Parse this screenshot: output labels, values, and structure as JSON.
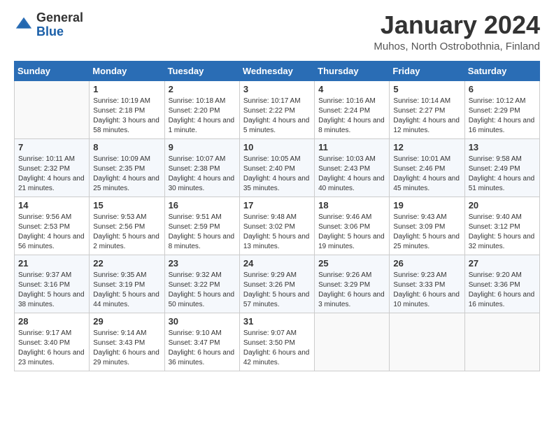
{
  "header": {
    "logo_general": "General",
    "logo_blue": "Blue",
    "month_title": "January 2024",
    "subtitle": "Muhos, North Ostrobothnia, Finland"
  },
  "days_of_week": [
    "Sunday",
    "Monday",
    "Tuesday",
    "Wednesday",
    "Thursday",
    "Friday",
    "Saturday"
  ],
  "weeks": [
    [
      {
        "day": "",
        "sunrise": "",
        "sunset": "",
        "daylight": ""
      },
      {
        "day": "1",
        "sunrise": "Sunrise: 10:19 AM",
        "sunset": "Sunset: 2:18 PM",
        "daylight": "Daylight: 3 hours and 58 minutes."
      },
      {
        "day": "2",
        "sunrise": "Sunrise: 10:18 AM",
        "sunset": "Sunset: 2:20 PM",
        "daylight": "Daylight: 4 hours and 1 minute."
      },
      {
        "day": "3",
        "sunrise": "Sunrise: 10:17 AM",
        "sunset": "Sunset: 2:22 PM",
        "daylight": "Daylight: 4 hours and 5 minutes."
      },
      {
        "day": "4",
        "sunrise": "Sunrise: 10:16 AM",
        "sunset": "Sunset: 2:24 PM",
        "daylight": "Daylight: 4 hours and 8 minutes."
      },
      {
        "day": "5",
        "sunrise": "Sunrise: 10:14 AM",
        "sunset": "Sunset: 2:27 PM",
        "daylight": "Daylight: 4 hours and 12 minutes."
      },
      {
        "day": "6",
        "sunrise": "Sunrise: 10:12 AM",
        "sunset": "Sunset: 2:29 PM",
        "daylight": "Daylight: 4 hours and 16 minutes."
      }
    ],
    [
      {
        "day": "7",
        "sunrise": "Sunrise: 10:11 AM",
        "sunset": "Sunset: 2:32 PM",
        "daylight": "Daylight: 4 hours and 21 minutes."
      },
      {
        "day": "8",
        "sunrise": "Sunrise: 10:09 AM",
        "sunset": "Sunset: 2:35 PM",
        "daylight": "Daylight: 4 hours and 25 minutes."
      },
      {
        "day": "9",
        "sunrise": "Sunrise: 10:07 AM",
        "sunset": "Sunset: 2:38 PM",
        "daylight": "Daylight: 4 hours and 30 minutes."
      },
      {
        "day": "10",
        "sunrise": "Sunrise: 10:05 AM",
        "sunset": "Sunset: 2:40 PM",
        "daylight": "Daylight: 4 hours and 35 minutes."
      },
      {
        "day": "11",
        "sunrise": "Sunrise: 10:03 AM",
        "sunset": "Sunset: 2:43 PM",
        "daylight": "Daylight: 4 hours and 40 minutes."
      },
      {
        "day": "12",
        "sunrise": "Sunrise: 10:01 AM",
        "sunset": "Sunset: 2:46 PM",
        "daylight": "Daylight: 4 hours and 45 minutes."
      },
      {
        "day": "13",
        "sunrise": "Sunrise: 9:58 AM",
        "sunset": "Sunset: 2:49 PM",
        "daylight": "Daylight: 4 hours and 51 minutes."
      }
    ],
    [
      {
        "day": "14",
        "sunrise": "Sunrise: 9:56 AM",
        "sunset": "Sunset: 2:53 PM",
        "daylight": "Daylight: 4 hours and 56 minutes."
      },
      {
        "day": "15",
        "sunrise": "Sunrise: 9:53 AM",
        "sunset": "Sunset: 2:56 PM",
        "daylight": "Daylight: 5 hours and 2 minutes."
      },
      {
        "day": "16",
        "sunrise": "Sunrise: 9:51 AM",
        "sunset": "Sunset: 2:59 PM",
        "daylight": "Daylight: 5 hours and 8 minutes."
      },
      {
        "day": "17",
        "sunrise": "Sunrise: 9:48 AM",
        "sunset": "Sunset: 3:02 PM",
        "daylight": "Daylight: 5 hours and 13 minutes."
      },
      {
        "day": "18",
        "sunrise": "Sunrise: 9:46 AM",
        "sunset": "Sunset: 3:06 PM",
        "daylight": "Daylight: 5 hours and 19 minutes."
      },
      {
        "day": "19",
        "sunrise": "Sunrise: 9:43 AM",
        "sunset": "Sunset: 3:09 PM",
        "daylight": "Daylight: 5 hours and 25 minutes."
      },
      {
        "day": "20",
        "sunrise": "Sunrise: 9:40 AM",
        "sunset": "Sunset: 3:12 PM",
        "daylight": "Daylight: 5 hours and 32 minutes."
      }
    ],
    [
      {
        "day": "21",
        "sunrise": "Sunrise: 9:37 AM",
        "sunset": "Sunset: 3:16 PM",
        "daylight": "Daylight: 5 hours and 38 minutes."
      },
      {
        "day": "22",
        "sunrise": "Sunrise: 9:35 AM",
        "sunset": "Sunset: 3:19 PM",
        "daylight": "Daylight: 5 hours and 44 minutes."
      },
      {
        "day": "23",
        "sunrise": "Sunrise: 9:32 AM",
        "sunset": "Sunset: 3:22 PM",
        "daylight": "Daylight: 5 hours and 50 minutes."
      },
      {
        "day": "24",
        "sunrise": "Sunrise: 9:29 AM",
        "sunset": "Sunset: 3:26 PM",
        "daylight": "Daylight: 5 hours and 57 minutes."
      },
      {
        "day": "25",
        "sunrise": "Sunrise: 9:26 AM",
        "sunset": "Sunset: 3:29 PM",
        "daylight": "Daylight: 6 hours and 3 minutes."
      },
      {
        "day": "26",
        "sunrise": "Sunrise: 9:23 AM",
        "sunset": "Sunset: 3:33 PM",
        "daylight": "Daylight: 6 hours and 10 minutes."
      },
      {
        "day": "27",
        "sunrise": "Sunrise: 9:20 AM",
        "sunset": "Sunset: 3:36 PM",
        "daylight": "Daylight: 6 hours and 16 minutes."
      }
    ],
    [
      {
        "day": "28",
        "sunrise": "Sunrise: 9:17 AM",
        "sunset": "Sunset: 3:40 PM",
        "daylight": "Daylight: 6 hours and 23 minutes."
      },
      {
        "day": "29",
        "sunrise": "Sunrise: 9:14 AM",
        "sunset": "Sunset: 3:43 PM",
        "daylight": "Daylight: 6 hours and 29 minutes."
      },
      {
        "day": "30",
        "sunrise": "Sunrise: 9:10 AM",
        "sunset": "Sunset: 3:47 PM",
        "daylight": "Daylight: 6 hours and 36 minutes."
      },
      {
        "day": "31",
        "sunrise": "Sunrise: 9:07 AM",
        "sunset": "Sunset: 3:50 PM",
        "daylight": "Daylight: 6 hours and 42 minutes."
      },
      {
        "day": "",
        "sunrise": "",
        "sunset": "",
        "daylight": ""
      },
      {
        "day": "",
        "sunrise": "",
        "sunset": "",
        "daylight": ""
      },
      {
        "day": "",
        "sunrise": "",
        "sunset": "",
        "daylight": ""
      }
    ]
  ]
}
